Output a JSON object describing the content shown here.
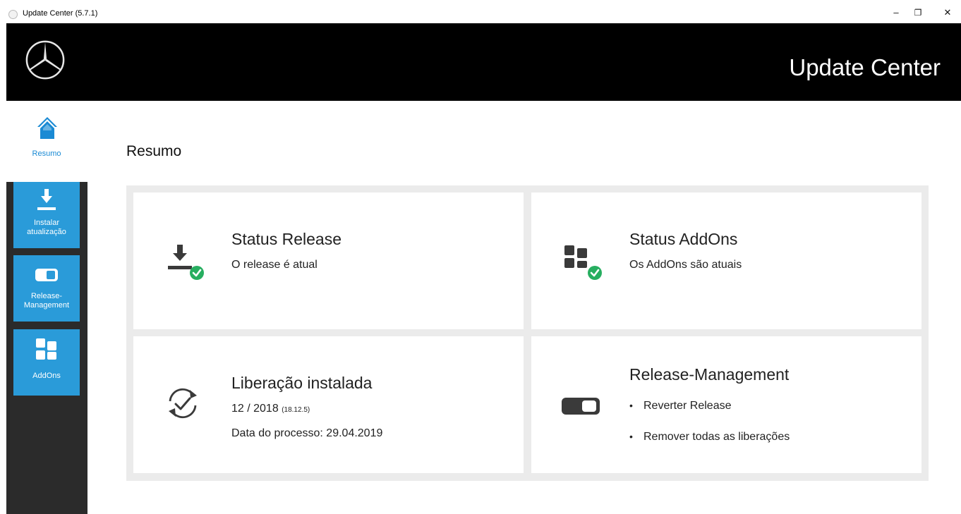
{
  "window": {
    "title": "Update Center (5.7.1)",
    "minimize": "–",
    "restore": "❐",
    "close": "✕"
  },
  "header": {
    "app_name": "Update Center",
    "logo_icon": "mercedes-star-icon"
  },
  "nav": {
    "home_label": "Resumo",
    "tiles": [
      {
        "label_line1": "Instalar",
        "label_line2": "atualização",
        "icon": "download-icon"
      },
      {
        "label_line1": "Release-",
        "label_line2": "Management",
        "icon": "toggle-icon"
      },
      {
        "label_line1": "AddOns",
        "label_line2": "",
        "icon": "addons-grid-icon"
      }
    ]
  },
  "main": {
    "page_title": "Resumo",
    "cards": {
      "status_release": {
        "title": "Status Release",
        "text": "O release é atual"
      },
      "status_addons": {
        "title": "Status AddOns",
        "text": "Os AddOns são atuais"
      },
      "installed": {
        "title": "Liberação instalada",
        "version": "12 / 2018",
        "version_detail": "(18.12.5)",
        "process_date": "Data do processo: 29.04.2019"
      },
      "release_management": {
        "title": "Release-Management",
        "bullet": "•",
        "items": [
          "Reverter Release",
          "Remover todas as liberações"
        ]
      }
    }
  },
  "colors": {
    "accent": "#2a9bd9",
    "success": "#27ae60",
    "header_bg": "#000000",
    "sidebar_bg": "#2b2b2b"
  }
}
